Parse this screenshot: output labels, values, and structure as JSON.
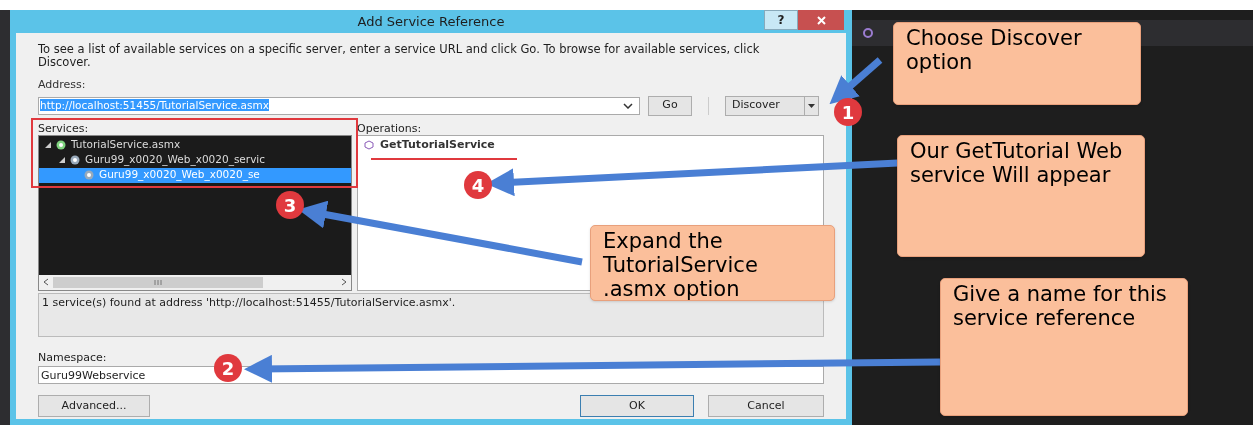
{
  "dialog": {
    "title": "Add Service Reference",
    "help_button": "?",
    "intro": "To see a list of available services on a specific server, enter a service URL and click Go. To browse for available services, click Discover.",
    "address_label": "Address:",
    "address_value": "http://localhost:51455/TutorialService.asmx",
    "address_selected": true,
    "go_button": "Go",
    "discover_button": "Discover",
    "services_label": "Services:",
    "services_tree": [
      {
        "label": "TutorialService.asmx",
        "expanded": true,
        "selected": false,
        "children": [
          {
            "label": "Guru99_x0020_Web_x0020_servic",
            "expanded": true,
            "selected": false,
            "children": [
              {
                "label": "Guru99_x0020_Web_x0020_se",
                "selected": true
              }
            ]
          }
        ]
      }
    ],
    "operations_label": "Operations:",
    "operations": [
      {
        "label": "GetTutorialService"
      }
    ],
    "status": "1 service(s) found at address 'http://localhost:51455/TutorialService.asmx'.",
    "namespace_label": "Namespace:",
    "namespace_value": "Guru99Webservice",
    "advanced_button": "Advanced...",
    "ok_button": "OK",
    "cancel_button": "Cancel"
  },
  "annotations": {
    "callouts": [
      {
        "text": "Choose Discover option"
      },
      {
        "text": "Our GetTutorial Web service Will appear"
      },
      {
        "text": "Expand the TutorialService .asmx option"
      },
      {
        "text": "Give a name for this service reference"
      }
    ],
    "markers": [
      "1",
      "2",
      "3",
      "4"
    ]
  }
}
